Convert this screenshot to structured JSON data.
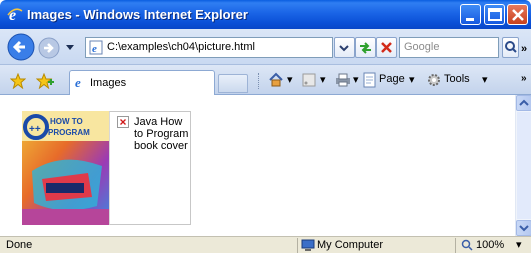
{
  "window": {
    "title": "Images - Windows Internet Explorer"
  },
  "addressbar": {
    "url": "C:\\examples\\ch04\\picture.html",
    "search_placeholder": "Google"
  },
  "tabs": [
    {
      "label": "Images"
    }
  ],
  "commandbar": {
    "page_label": "Page",
    "tools_label": "Tools"
  },
  "content": {
    "broken_image_alt": "Java How to Program book cover"
  },
  "statusbar": {
    "status": "Done",
    "zone": "My Computer",
    "zoom": "100%"
  },
  "colors": {
    "titlebar": "#0a4fd6",
    "close_button": "#c8401e",
    "status_bg": "#ece9d8"
  }
}
